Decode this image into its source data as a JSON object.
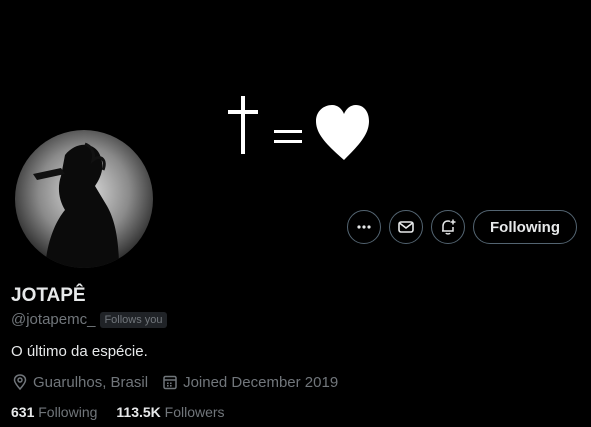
{
  "profile": {
    "name": "JOTAPÊ",
    "handle": "@jotapemc_",
    "follows_you_badge": "Follows you",
    "bio": "O último da espécie.",
    "location": "Guarulhos, Brasil",
    "joined": "Joined December 2019",
    "following_count": "631",
    "following_label": "Following",
    "followers_count": "113.5K",
    "followers_label": "Followers"
  },
  "actions": {
    "more_icon": "more-icon",
    "message_icon": "mail-icon",
    "notify_icon": "bell-plus-icon",
    "follow_label": "Following"
  },
  "banner": {
    "icons": [
      "cross-icon",
      "equals-icon",
      "heart-icon"
    ]
  },
  "colors": {
    "background": "#000000",
    "text_primary": "#e7e9ea",
    "text_secondary": "#71767b",
    "border": "#536471"
  }
}
